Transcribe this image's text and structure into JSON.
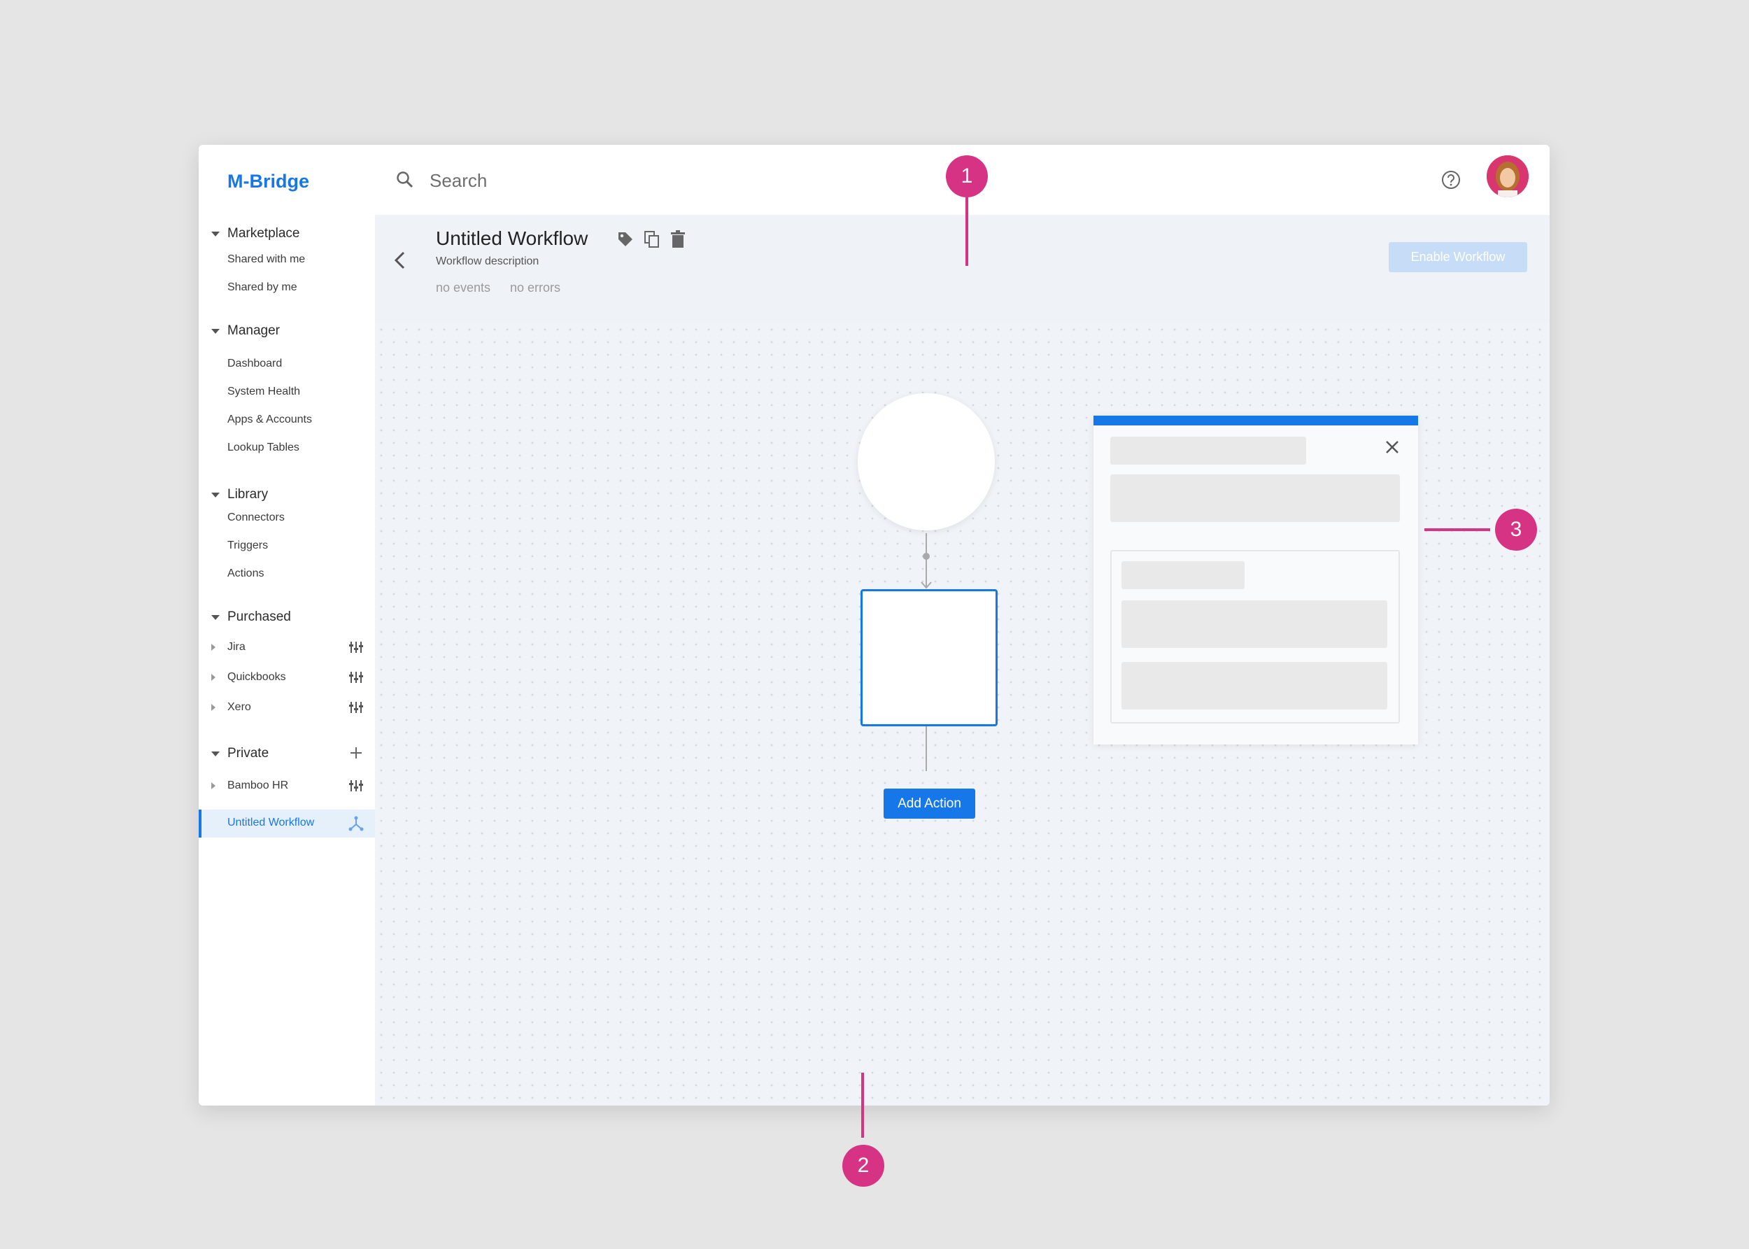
{
  "app": {
    "brand": "M-Bridge"
  },
  "sidebar": {
    "sections": [
      {
        "title": "Marketplace",
        "items": [
          "Shared with me",
          "Shared by me"
        ]
      },
      {
        "title": "Manager",
        "items": [
          "Dashboard",
          "System Health",
          "Apps & Accounts",
          "Lookup Tables"
        ]
      },
      {
        "title": "Library",
        "items": [
          "Connectors",
          "Triggers",
          "Actions"
        ]
      },
      {
        "title": "Purchased",
        "items": [
          "Jira",
          "Quickbooks",
          "Xero"
        ]
      },
      {
        "title": "Private",
        "items": [
          "Bamboo HR"
        ]
      }
    ],
    "active_item": "Untitled Workflow"
  },
  "topbar": {
    "search_placeholder": "Search"
  },
  "workflow": {
    "title": "Untitled Workflow",
    "description": "Workflow description",
    "events": "no events",
    "errors": "no errors",
    "enable_label": "Enable Workflow"
  },
  "canvas": {
    "add_action_label": "Add Action"
  },
  "annotations": [
    "1",
    "2",
    "3"
  ],
  "colors": {
    "accent": "#1677e8",
    "annotation": "#d63384",
    "canvas_bg": "#f0f3f7"
  }
}
